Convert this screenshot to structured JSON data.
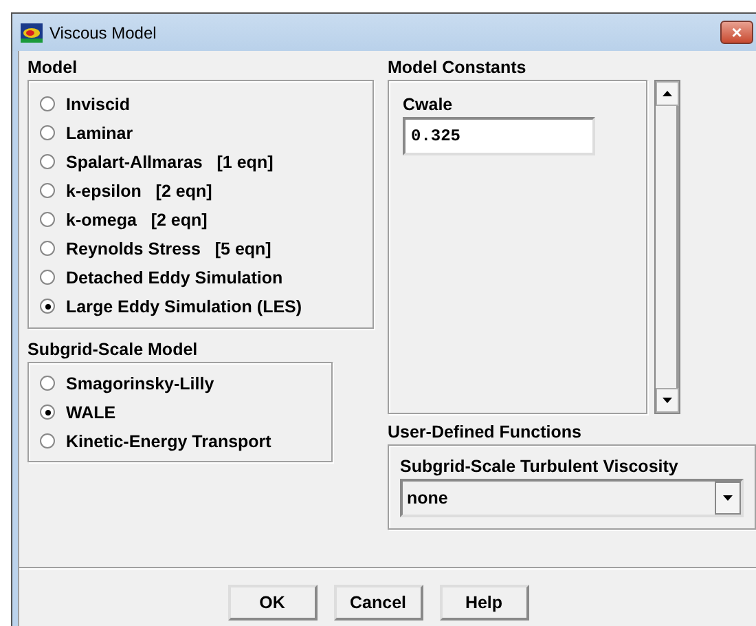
{
  "window": {
    "title": "Viscous Model",
    "close": "×"
  },
  "model": {
    "label": "Model",
    "options": [
      {
        "label": "Inviscid",
        "selected": false
      },
      {
        "label": "Laminar",
        "selected": false
      },
      {
        "label": "Spalart-Allmaras   [1 eqn]",
        "selected": false
      },
      {
        "label": "k-epsilon   [2 eqn]",
        "selected": false
      },
      {
        "label": "k-omega   [2 eqn]",
        "selected": false
      },
      {
        "label": "Reynolds Stress   [5 eqn]",
        "selected": false
      },
      {
        "label": "Detached Eddy Simulation",
        "selected": false
      },
      {
        "label": "Large Eddy Simulation (LES)",
        "selected": true
      }
    ]
  },
  "subgrid": {
    "label": "Subgrid-Scale Model",
    "options": [
      {
        "label": "Smagorinsky-Lilly",
        "selected": false
      },
      {
        "label": "WALE",
        "selected": true
      },
      {
        "label": "Kinetic-Energy Transport",
        "selected": false
      }
    ]
  },
  "constants": {
    "label": "Model Constants",
    "fields": [
      {
        "label": "Cwale",
        "value": "0.325"
      }
    ]
  },
  "udf": {
    "label": "User-Defined Functions",
    "fields": [
      {
        "label": "Subgrid-Scale Turbulent Viscosity",
        "value": "none"
      }
    ]
  },
  "buttons": [
    "OK",
    "Cancel",
    "Help"
  ]
}
